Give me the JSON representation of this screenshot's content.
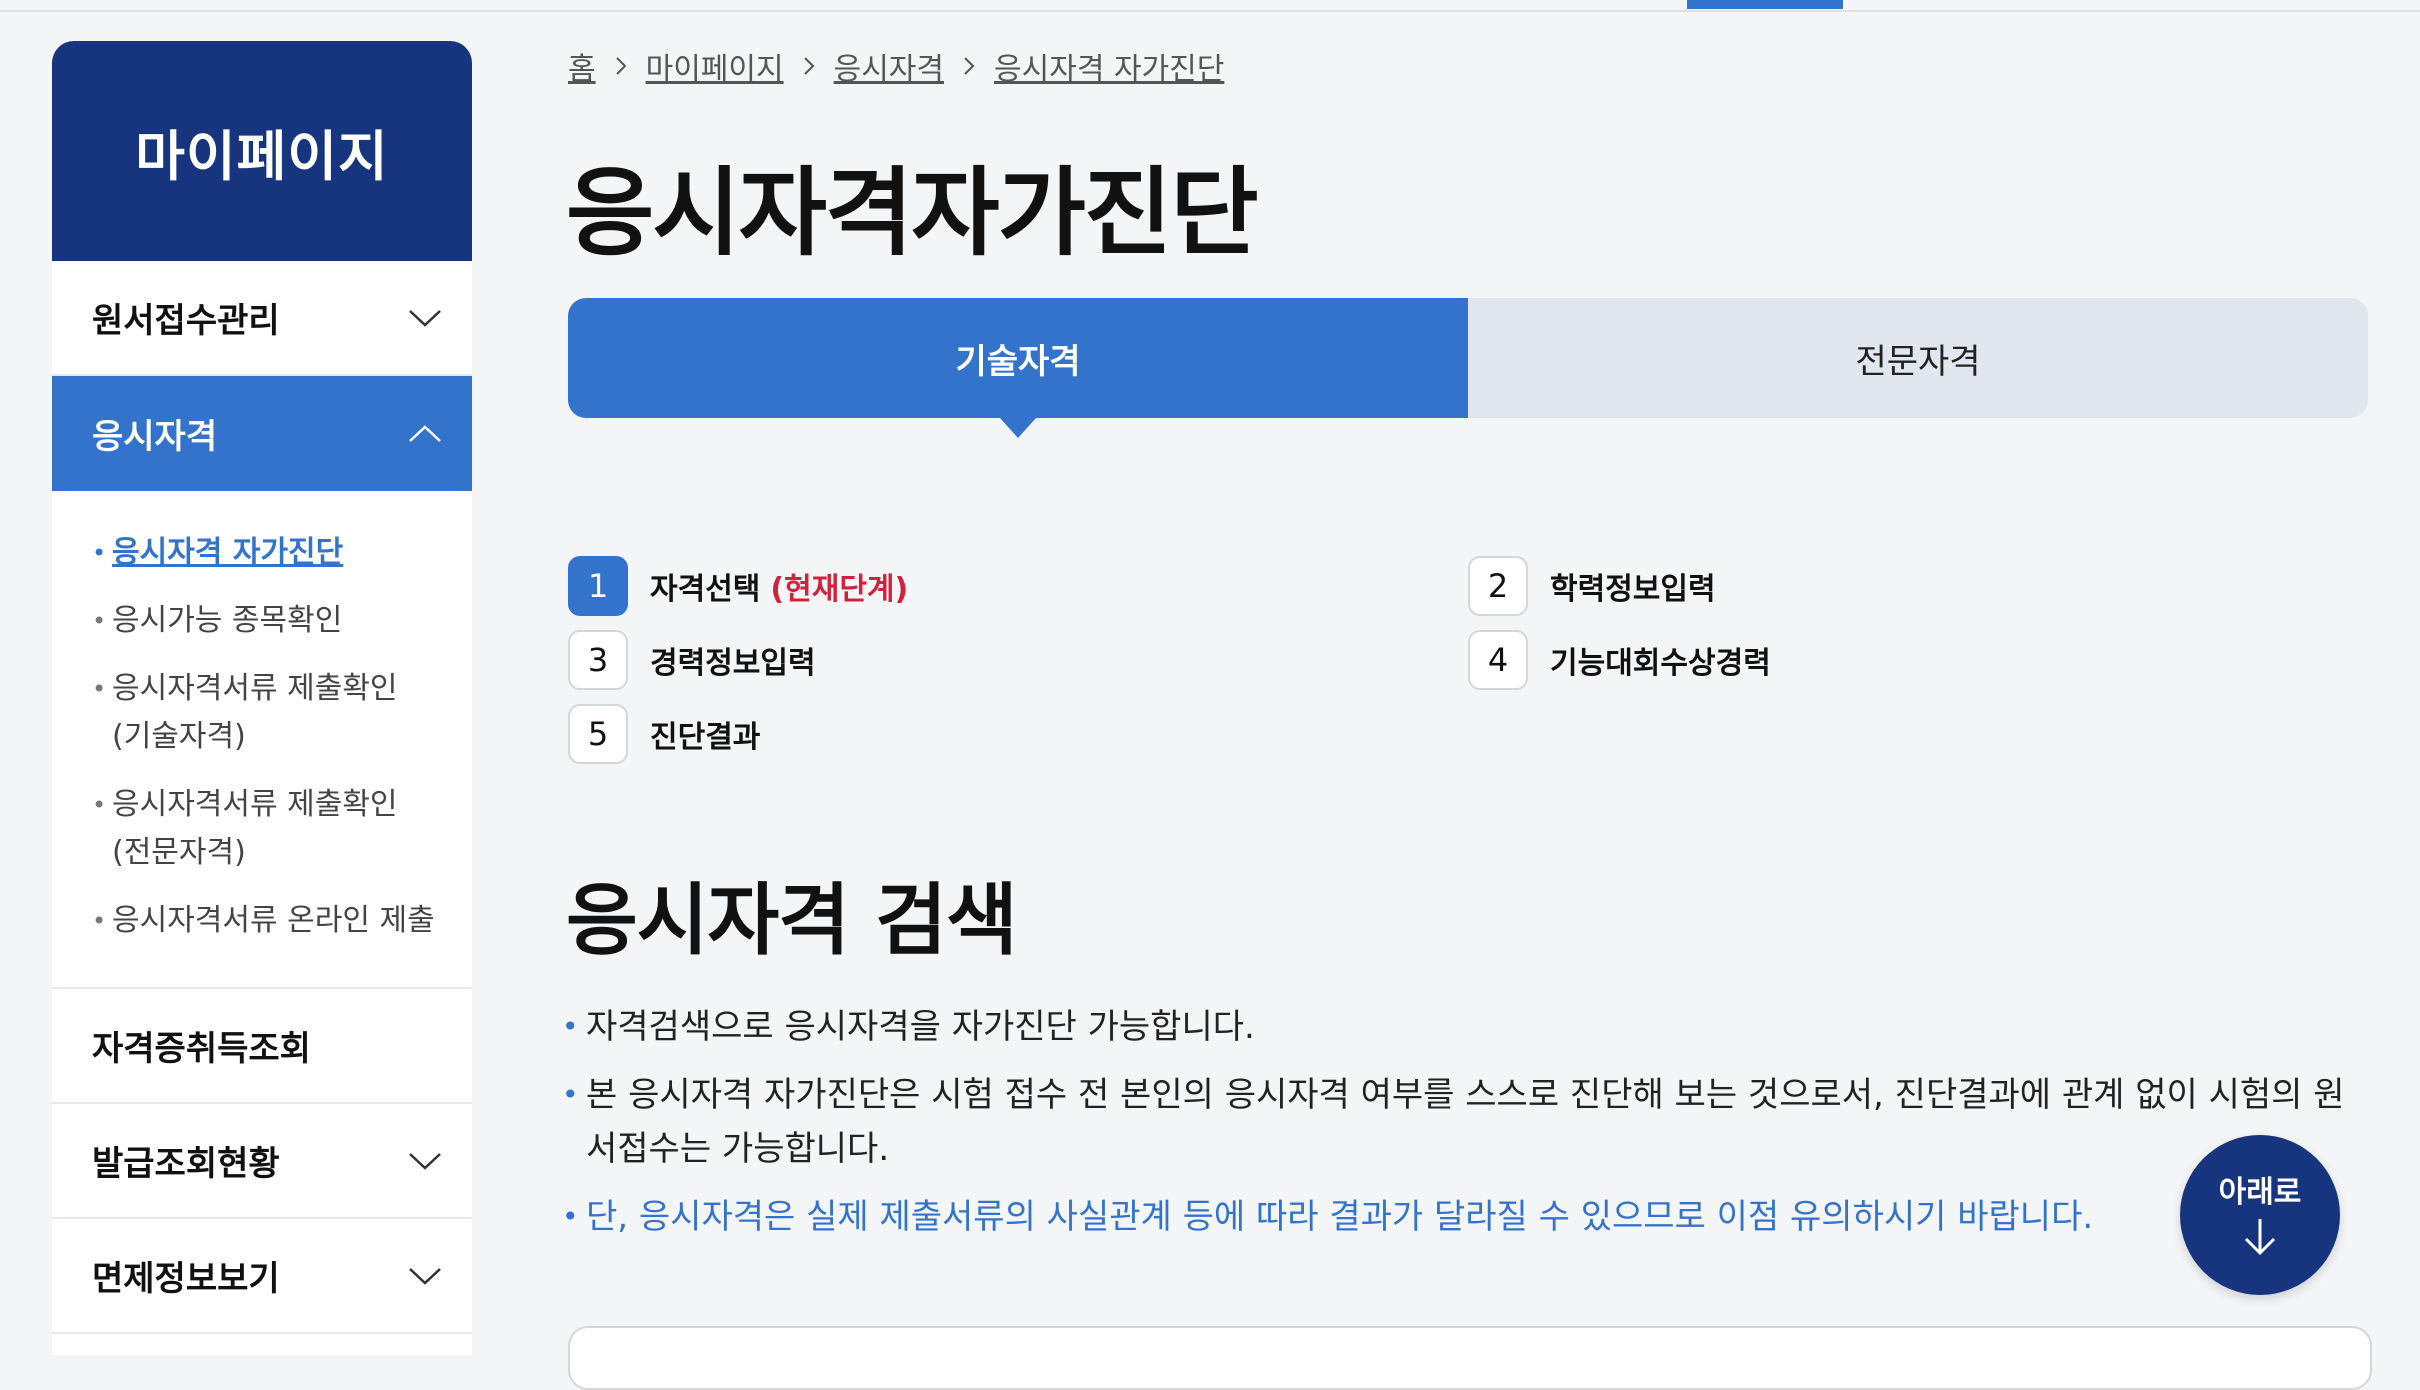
{
  "sidebar": {
    "title": "마이페이지",
    "items": [
      {
        "label": "원서접수관리"
      },
      {
        "label": "응시자격"
      },
      {
        "label": "자격증취득조회"
      },
      {
        "label": "발급조회현황"
      },
      {
        "label": "면제정보보기"
      }
    ],
    "submenu": [
      {
        "label": "응시자격 자가진단"
      },
      {
        "label": "응시가능 종목확인"
      },
      {
        "label": "응시자격서류 제출확인 (기술자격)"
      },
      {
        "label": "응시자격서류 제출확인 (전문자격)"
      },
      {
        "label": "응시자격서류 온라인 제출"
      }
    ]
  },
  "breadcrumb": [
    "홈",
    "마이페이지",
    "응시자격",
    "응시자격 자가진단"
  ],
  "page_title": "응시자격자가진단",
  "tabs": [
    {
      "label": "기술자격",
      "active": true
    },
    {
      "label": "전문자격",
      "active": false
    }
  ],
  "steps": [
    {
      "num": "1",
      "label": "자격선택",
      "status": "(현재단계)"
    },
    {
      "num": "2",
      "label": "학력정보입력"
    },
    {
      "num": "3",
      "label": "경력정보입력"
    },
    {
      "num": "4",
      "label": "기능대회수상경력"
    },
    {
      "num": "5",
      "label": "진단결과"
    }
  ],
  "section_title": "응시자격 검색",
  "notes": [
    "자격검색으로 응시자격을 자가진단 가능합니다.",
    "본 응시자격 자가진단은 시험 접수 전 본인의 응시자격 여부를 스스로 진단해 보는 것으로서, 진단결과에 관계 없이 시험의 원서접수는 가능합니다.",
    "단, 응시자격은 실제 제출서류의 사실관계 등에 따라 결과가 달라질 수 있으므로 이점 유의하시기 바랍니다."
  ],
  "down_button": {
    "label": "아래로"
  },
  "colors": {
    "primary": "#3473cc",
    "navy": "#17357f",
    "alert": "#d0223d",
    "background": "#f4f5f7"
  },
  "icons": {
    "chevron_down": "chevron-down-icon",
    "chevron_up": "chevron-up-icon",
    "breadcrumb_sep": "chevron-right-icon",
    "down_arrow": "arrow-down-icon"
  }
}
